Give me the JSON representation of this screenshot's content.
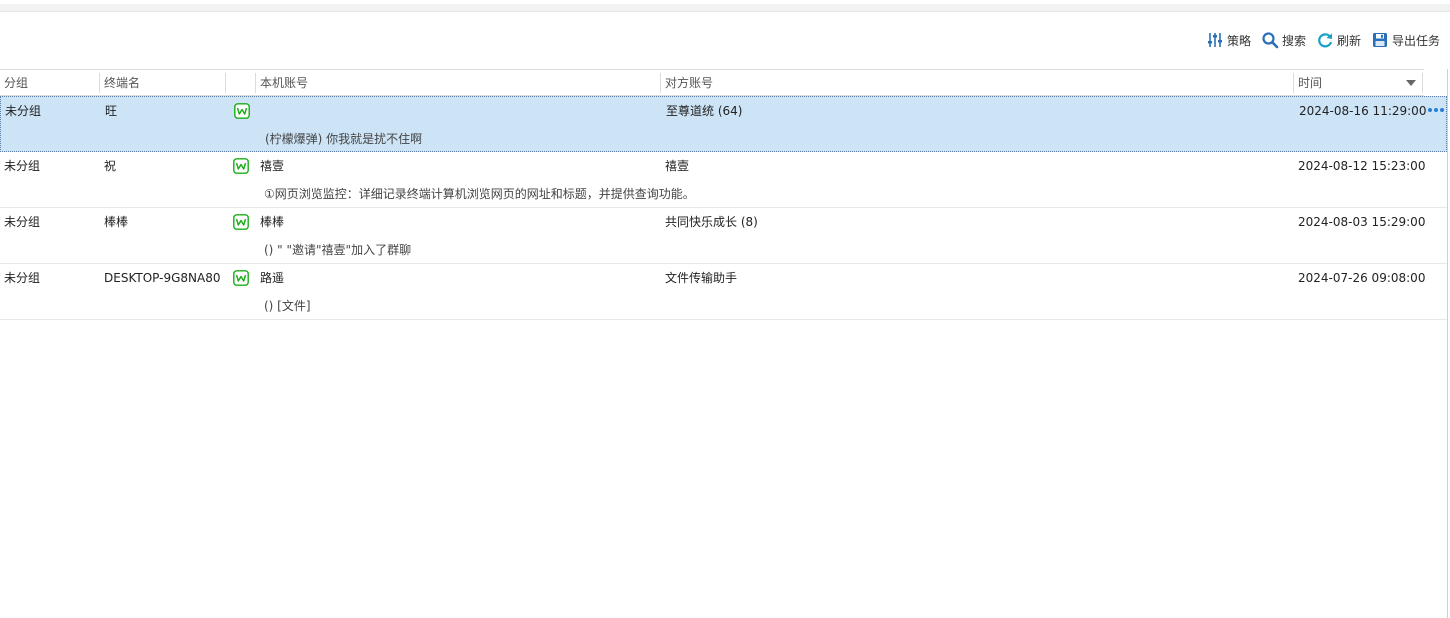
{
  "toolbar": {
    "strategy_label": "策略",
    "search_label": "搜索",
    "refresh_label": "刷新",
    "export_label": "导出任务"
  },
  "columns": {
    "group": "分组",
    "terminal": "终端名",
    "local_account": "本机账号",
    "peer_account": "对方账号",
    "time": "时间"
  },
  "colors": {
    "selected_row": "#cde4f7",
    "accent_blue": "#2a7fd4",
    "wechat_green": "#1aad19"
  },
  "rows": [
    {
      "group": "未分组",
      "terminal": "旺",
      "app_icon": "wechat-icon",
      "local_account": "",
      "peer_account": "至尊道统 (64)",
      "time": "2024-08-16 11:29:00",
      "message": "(柠檬爆弹) 你我就是扰不住啊",
      "selected": true
    },
    {
      "group": "未分组",
      "terminal": "祝",
      "app_icon": "wechat-icon",
      "local_account": "禧壹",
      "peer_account": "禧壹",
      "time": "2024-08-12 15:23:00",
      "message": "①网页浏览监控：详细记录终端计算机浏览网页的网址和标题，并提供查询功能。",
      "selected": false
    },
    {
      "group": "未分组",
      "terminal": "棒棒",
      "app_icon": "wechat-icon",
      "local_account": "棒棒",
      "peer_account": "共同快乐成长 (8)",
      "time": "2024-08-03 15:29:00",
      "message": "() \"      \"邀请\"禧壹\"加入了群聊",
      "selected": false
    },
    {
      "group": "未分组",
      "terminal": "DESKTOP-9G8NA80",
      "app_icon": "wechat-icon",
      "local_account": "路遥",
      "peer_account": "文件传输助手",
      "time": "2024-07-26 09:08:00",
      "message": "() [文件]",
      "selected": false
    }
  ]
}
